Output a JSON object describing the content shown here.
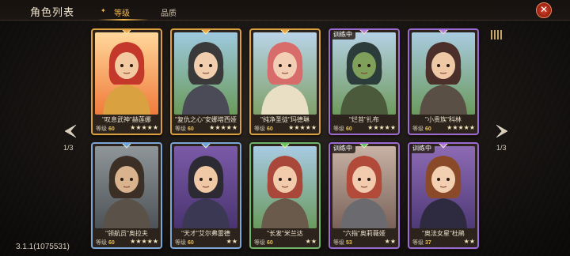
{
  "header": {
    "title": "角色列表",
    "tabs": [
      {
        "label": "等级"
      },
      {
        "label": "品质"
      }
    ],
    "close": "✕"
  },
  "pagination": {
    "left": "1/3",
    "right": "1/3"
  },
  "version": "3.1.1(1075531)",
  "level_label": "等级",
  "cards": [
    {
      "name": "\"叹息武神\"赫莲娜",
      "level": "60",
      "stars": "★★★★★",
      "training": "",
      "frame": "gold",
      "gem": "#f2a23b",
      "palette": {
        "bg1": "#ffd79a",
        "bg2": "#f07b3c",
        "hair": "#c4382b",
        "skin": "#f3c9a1",
        "outfit": "#d9a13f"
      }
    },
    {
      "name": "\"复仇之心\"安娜塔西娅",
      "level": "60",
      "stars": "★★★★★",
      "training": "",
      "frame": "gold",
      "gem": "#f2a23b",
      "palette": {
        "bg1": "#9ec9df",
        "bg2": "#6a9a5a",
        "hair": "#3a3a3a",
        "skin": "#f1cfae",
        "outfit": "#4a4b57"
      }
    },
    {
      "name": "\"纯净圣徒\"玛德琳",
      "level": "60",
      "stars": "★★★★★",
      "training": "",
      "frame": "gold",
      "gem": "#f2a23b",
      "palette": {
        "bg1": "#b9d4e8",
        "bg2": "#7fa06a",
        "hair": "#d76c6a",
        "skin": "#f2cfb4",
        "outfit": "#e9dfc4"
      }
    },
    {
      "name": "\"烂苔\"扎布",
      "level": "60",
      "stars": "★★★★★",
      "training": "训练中",
      "frame": "purple",
      "gem": "#b37be4",
      "palette": {
        "bg1": "#b5d1e5",
        "bg2": "#6f9a5e",
        "hair": "#2b3c3a",
        "skin": "#7fa05a",
        "outfit": "#4b5a3a"
      }
    },
    {
      "name": "\"小贵族\"科林",
      "level": "60",
      "stars": "★★★★★",
      "training": "",
      "frame": "purple",
      "gem": "#b37be4",
      "palette": {
        "bg1": "#a9cbe0",
        "bg2": "#6b9a5e",
        "hair": "#4a2f2a",
        "skin": "#efc9a6",
        "outfit": "#5a4f44"
      }
    },
    {
      "name": "\"领航员\"奥拉夫",
      "level": "60",
      "stars": "★★★★★",
      "training": "",
      "frame": "blue",
      "gem": "#5fa3e6",
      "palette": {
        "bg1": "#8f969a",
        "bg2": "#4c5256",
        "hair": "#3b2f26",
        "skin": "#d9b28e",
        "outfit": "#5a5148"
      }
    },
    {
      "name": "\"天才\"艾尔弗雷德",
      "level": "60",
      "stars": "★★",
      "training": "",
      "frame": "blue",
      "gem": "#5fa3e6",
      "palette": {
        "bg1": "#7b5aa8",
        "bg2": "#4a3470",
        "hair": "#2c2a32",
        "skin": "#efc8a5",
        "outfit": "#3b3854"
      }
    },
    {
      "name": "\"长发\"米兰达",
      "level": "60",
      "stars": "★★",
      "training": "",
      "frame": "green",
      "gem": "#5fc85a",
      "palette": {
        "bg1": "#a8cbe3",
        "bg2": "#6a9a5e",
        "hair": "#a8473a",
        "skin": "#f1cbab",
        "outfit": "#6a5a4c"
      }
    },
    {
      "name": "\"六指\"奥莉薇娅",
      "level": "53",
      "stars": "★★",
      "training": "训练中",
      "frame": "purple",
      "gem": "#5fc85a",
      "palette": {
        "bg1": "#c7b2a5",
        "bg2": "#7a6258",
        "hair": "#b24a3a",
        "skin": "#f2cbae",
        "outfit": "#6b6a6e"
      }
    },
    {
      "name": "\"奥法女星\"杜鹃",
      "level": "37",
      "stars": "★★",
      "training": "训练中",
      "frame": "purple",
      "gem": "#b37be4",
      "palette": {
        "bg1": "#8d6bb4",
        "bg2": "#4f3a78",
        "hair": "#8a4a2a",
        "skin": "#f2cfb1",
        "outfit": "#2e2a40"
      }
    }
  ]
}
